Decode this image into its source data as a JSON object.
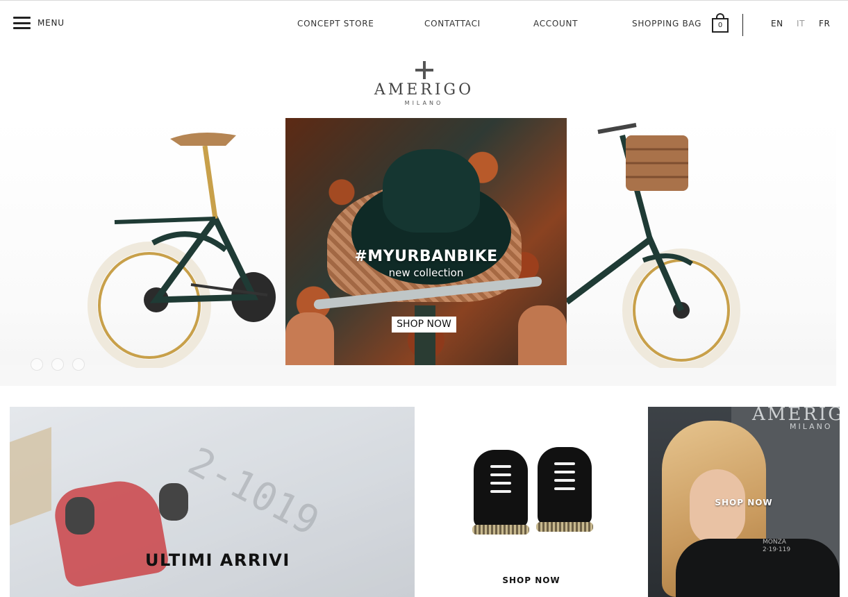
{
  "header": {
    "menu_label": "MENU",
    "nav": [
      {
        "label": "CONCEPT STORE"
      },
      {
        "label": "CONTATTACI"
      },
      {
        "label": "ACCOUNT"
      },
      {
        "label": "SHOPPING BAG"
      }
    ],
    "bag_count": "0",
    "languages": [
      {
        "code": "EN",
        "active": false
      },
      {
        "code": "IT",
        "active": true
      },
      {
        "code": "FR",
        "active": false
      }
    ]
  },
  "logo": {
    "name": "AMERIGO",
    "sub": "MILANO"
  },
  "hero": {
    "title": "#MYURBANBIKE",
    "subtitle": "new collection",
    "cta": "SHOP NOW",
    "slide_count": 3
  },
  "tiles": [
    {
      "label": "ULTIMI ARRIVI"
    },
    {
      "label": "SHOP NOW"
    },
    {
      "label": "SHOP NOW",
      "brand": "AMERIGO",
      "brand_sub": "MILANO",
      "shirt_text": "MONZA\n2·19·119"
    }
  ],
  "colors": {
    "text": "#222222",
    "inactive_lang": "#999999",
    "accent_bike": "#c8a04a"
  }
}
